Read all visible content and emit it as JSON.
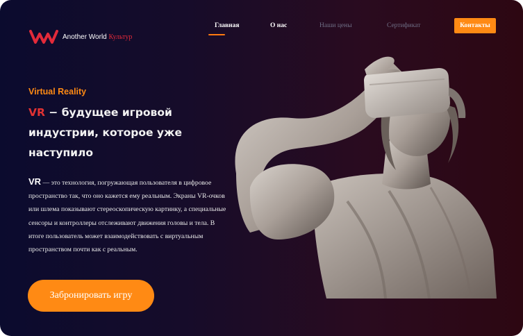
{
  "brand": {
    "name": "Another World",
    "accent": "Культур",
    "logo_icon": "w-wave-logo-icon",
    "logo_color": "#e32a3a"
  },
  "nav": {
    "items": [
      {
        "label": "Главная",
        "active": true
      },
      {
        "label": "О нас",
        "active": false
      },
      {
        "label": "Наши цены",
        "active": false
      },
      {
        "label": "Сертификат",
        "active": false
      }
    ],
    "contact_label": "Контакты"
  },
  "hero": {
    "kicker": "Virtual Reality",
    "headline_accent": "VR",
    "headline_rest": " − будущее игровой индустрии, которое уже наступило",
    "body_accent": "VR",
    "body_text": " — это технология, погружающая пользователя в цифровое пространство так, что оно кажется ему реальным. Экраны VR-очков или шлема показывают стереоскопическую картинку, а специальные сенсоры и контроллеры отслеживают движения головы и тела. В итоге пользователь может взаимодействовать с виртуальным пространством почти как с реальным.",
    "cta_label": "Забронировать игру"
  },
  "colors": {
    "accent_orange": "#ff8a14",
    "accent_red": "#e03233",
    "bg_left": "#0b0b2e",
    "bg_right": "#2d0712"
  }
}
